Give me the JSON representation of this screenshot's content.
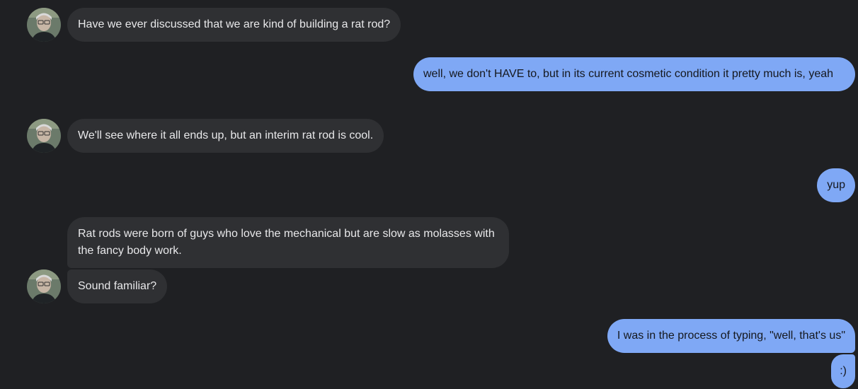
{
  "conversation": {
    "messages": [
      {
        "sender": "contact",
        "text": "Have we ever discussed that we are kind of building a rat rod?"
      },
      {
        "sender": "self",
        "text": "well, we don't HAVE to, but in its current cosmetic condition it pretty much is, yeah"
      },
      {
        "sender": "contact",
        "text": "We'll see where it all ends up, but an interim rat rod is cool."
      },
      {
        "sender": "self",
        "text": "yup"
      },
      {
        "sender": "contact",
        "text": "Rat rods were born of guys who love the mechanical but are slow as molasses with the fancy body work."
      },
      {
        "sender": "contact",
        "text": "Sound familiar?"
      },
      {
        "sender": "self",
        "text": "I was in the process of typing, \"well, that's us\""
      },
      {
        "sender": "self",
        "text": ":)"
      }
    ]
  },
  "colors": {
    "background": "#1f2023",
    "incoming_bubble": "#2f3033",
    "outgoing_bubble": "#7fa8f5"
  }
}
